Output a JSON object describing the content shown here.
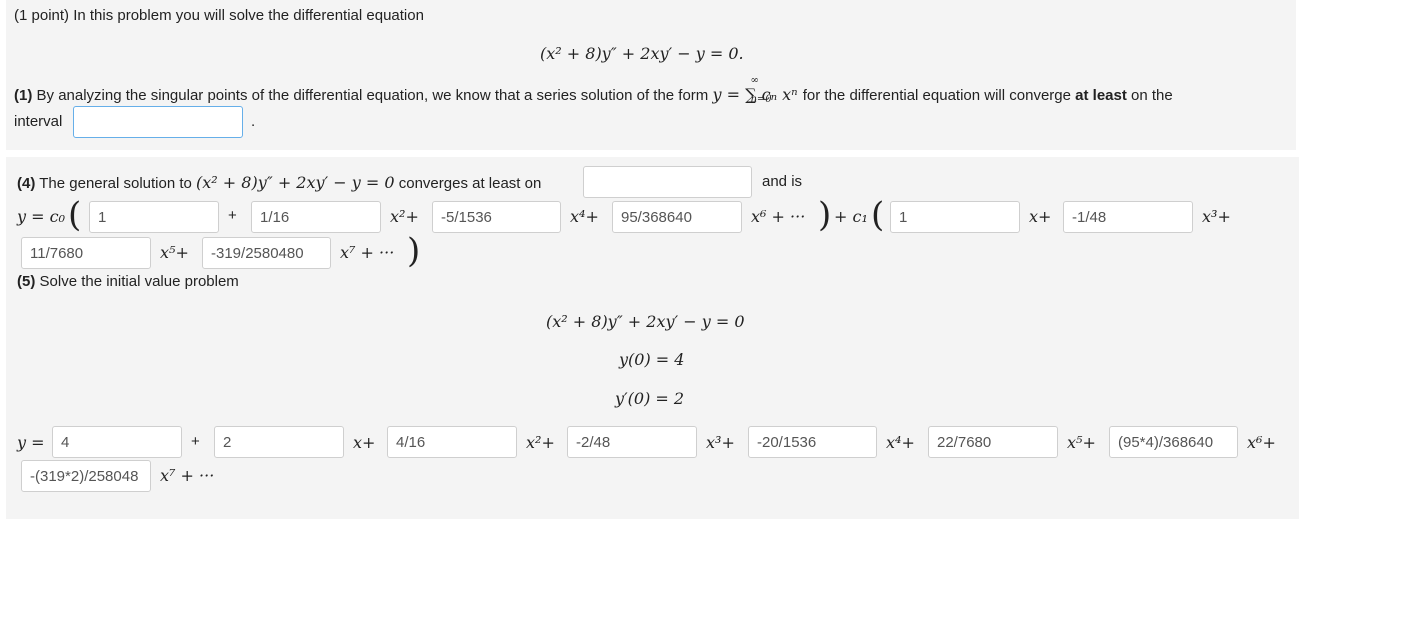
{
  "intro": {
    "text": "(1 point) In this problem you will solve the differential equation",
    "equation": "(x² + 8)y″ + 2xy′ − y = 0."
  },
  "part1": {
    "label": "(1)",
    "text_before": "By analyzing the singular points of the differential equation, we know that a series solution of the form",
    "series": "y = ∑ cₙ xⁿ",
    "series_sup": "∞",
    "series_sub": "n=0",
    "text_after": "for the differential equation will converge",
    "bold": "at least",
    "text_end": "on the",
    "interval_label": "interval",
    "interval_value": "",
    "period": "."
  },
  "part4": {
    "label": "(4)",
    "text_before": "The general solution to",
    "equation": "(x² + 8)y″ + 2xy′ − y = 0",
    "text_mid": "converges at least on",
    "converge_value": "",
    "text_end": "and is",
    "y_c0": "y = c₀",
    "plus": "+",
    "x2": "x²+",
    "x4": "x⁴+",
    "x6_tail": "x⁶ + ···",
    "close_plus_c1": "+ c₁",
    "x1": "x+",
    "x3": "x³+",
    "x5": "x⁵+",
    "x7_tail": "x⁷ + ···",
    "c0_values": [
      "1",
      "1/16",
      "-5/1536",
      "95/368640"
    ],
    "c1_values": [
      "1",
      "-1/48",
      "11/7680",
      "-319/2580480"
    ]
  },
  "part5": {
    "label": "(5)",
    "text": "Solve the initial value problem",
    "eq1": "(x² + 8)y″ + 2xy′ − y = 0",
    "eq2": "y(0) = 4",
    "eq3": "y′(0) = 2",
    "y_eq": "y =",
    "plus": "+",
    "x1": "x+",
    "x2": "x²+",
    "x3": "x³+",
    "x4": "x⁴+",
    "x5": "x⁵+",
    "x6": "x⁶+",
    "x7_tail": "x⁷ + ···",
    "values": [
      "4",
      "2",
      "4/16",
      "-2/48",
      "-20/1536",
      "22/7680",
      "(95*4)/368640",
      "-(319*2)/258048"
    ]
  }
}
